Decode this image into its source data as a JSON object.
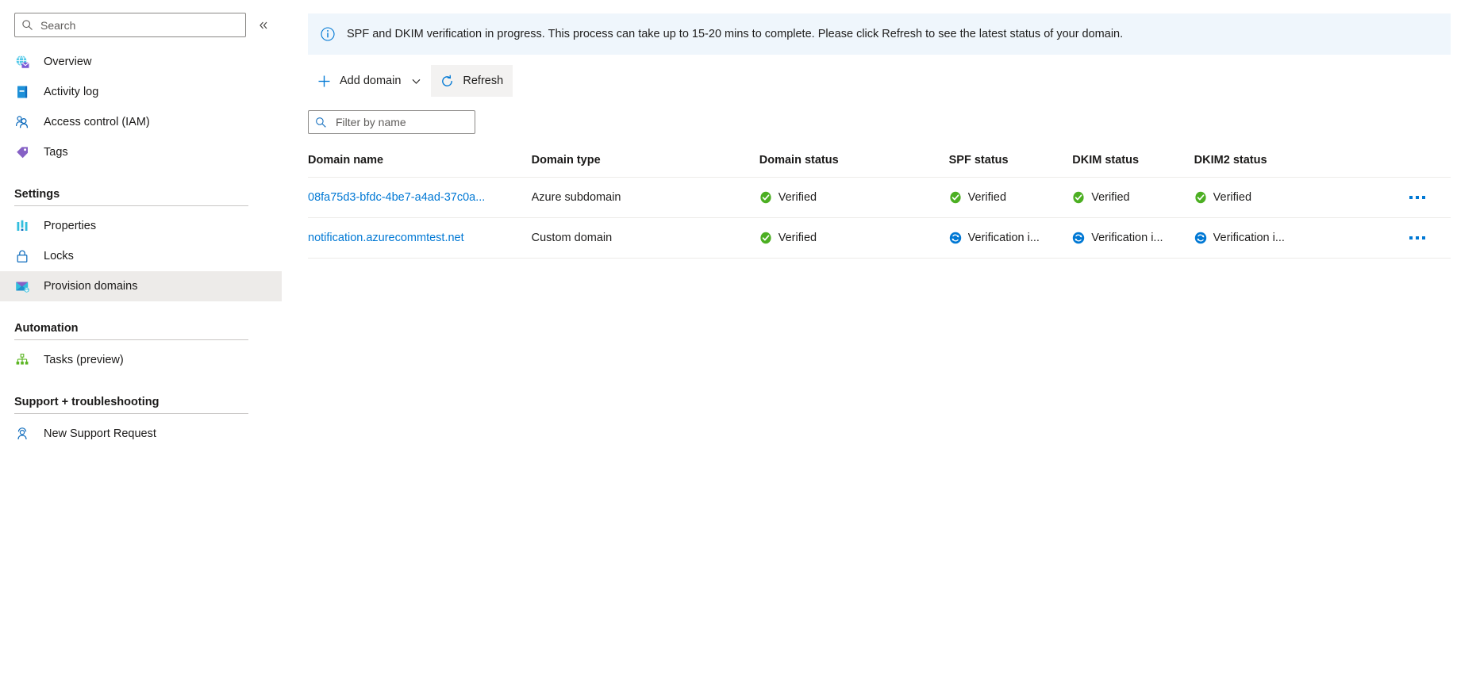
{
  "sidebar": {
    "search": {
      "placeholder": "Search",
      "value": "",
      "icon": "search-icon"
    },
    "collapse_label": "«",
    "items": [
      {
        "label": "Overview",
        "icon": "overview-globe-mail-icon",
        "selected": false
      },
      {
        "label": "Activity log",
        "icon": "activity-log-book-icon",
        "selected": false
      },
      {
        "label": "Access control (IAM)",
        "icon": "access-control-people-icon",
        "selected": false
      },
      {
        "label": "Tags",
        "icon": "tag-icon",
        "selected": false
      }
    ],
    "groups": [
      {
        "title": "Settings",
        "items": [
          {
            "label": "Properties",
            "icon": "properties-bars-icon",
            "selected": false
          },
          {
            "label": "Locks",
            "icon": "lock-icon",
            "selected": false
          },
          {
            "label": "Provision domains",
            "icon": "provision-domains-mail-icon",
            "selected": true
          }
        ]
      },
      {
        "title": "Automation",
        "items": [
          {
            "label": "Tasks (preview)",
            "icon": "tasks-hierarchy-icon",
            "selected": false
          }
        ]
      },
      {
        "title": "Support + troubleshooting",
        "items": [
          {
            "label": "New Support Request",
            "icon": "support-person-icon",
            "selected": false
          }
        ]
      }
    ]
  },
  "banner": {
    "icon": "info-circle-icon",
    "text": "SPF and DKIM verification in progress. This process can take up to 15-20 mins to complete. Please click Refresh to see the latest status of your domain.",
    "background": "#eff6fc"
  },
  "toolbar": {
    "add_domain_label": "Add domain",
    "add_domain_icon": "plus-icon",
    "add_domain_caret": "chevron-down-icon",
    "refresh_label": "Refresh",
    "refresh_icon": "refresh-circular-arrow-icon"
  },
  "filter": {
    "placeholder": "Filter by name",
    "value": "",
    "icon": "search-icon"
  },
  "table": {
    "columns": [
      "Domain name",
      "Domain type",
      "Domain status",
      "SPF status",
      "DKIM status",
      "DKIM2 status"
    ],
    "rows": [
      {
        "domain_name": "08fa75d3-bfdc-4be7-a4ad-37c0a...",
        "domain_type": "Azure subdomain",
        "domain_status": "Verified",
        "domain_status_icon": "verified-check-icon",
        "spf_status": "Verified",
        "spf_status_icon": "verified-check-icon",
        "dkim_status": "Verified",
        "dkim_status_icon": "verified-check-icon",
        "dkim2_status": "Verified",
        "dkim2_status_icon": "verified-check-icon",
        "menu_label": "..."
      },
      {
        "domain_name": "notification.azurecommtest.net",
        "domain_type": "Custom domain",
        "domain_status": "Verified",
        "domain_status_icon": "verified-check-icon",
        "spf_status": "Verification i...",
        "spf_status_icon": "in-progress-icon",
        "dkim_status": "Verification i...",
        "dkim_status_icon": "in-progress-icon",
        "dkim2_status": "Verification i...",
        "dkim2_status_icon": "in-progress-icon",
        "menu_label": "..."
      }
    ]
  },
  "colors": {
    "link": "#0078d4",
    "verified_green": "#4caf22",
    "in_progress_blue": "#0078d4",
    "selected_nav": "#edebe9",
    "banner_bg": "#eff6fc"
  }
}
